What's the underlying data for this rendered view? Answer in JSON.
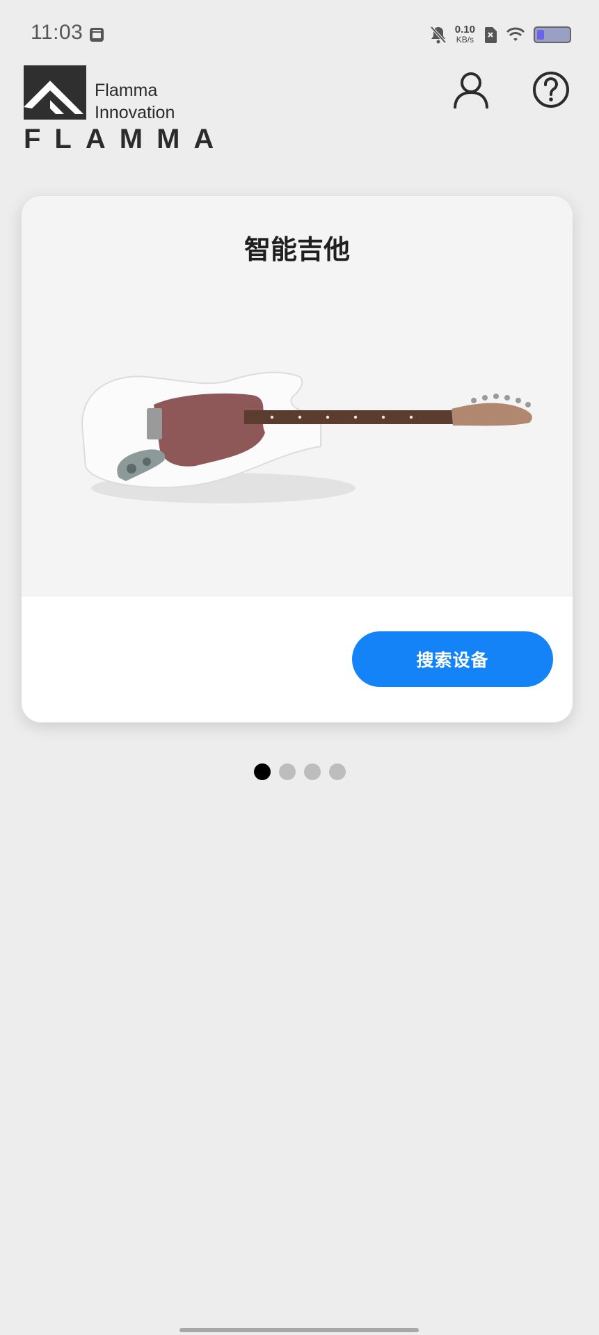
{
  "status_bar": {
    "time": "11:03",
    "net_speed_value": "0.10",
    "net_speed_unit": "KB/s",
    "icons": [
      "calendar-icon",
      "mute-icon",
      "no-sim-icon",
      "wifi-icon",
      "battery-icon"
    ]
  },
  "header": {
    "logo_line1": "Flamma",
    "logo_line2": "Innovation",
    "logo_wordmark": "FLAMMA",
    "profile_icon": "user-icon",
    "help_icon": "help-icon"
  },
  "card": {
    "title": "智能吉他",
    "search_button_label": "搜索设备"
  },
  "pager": {
    "count": 4,
    "active_index": 0
  },
  "colors": {
    "accent": "#1583f8",
    "background": "#ededed",
    "card_top": "#f4f4f4"
  }
}
